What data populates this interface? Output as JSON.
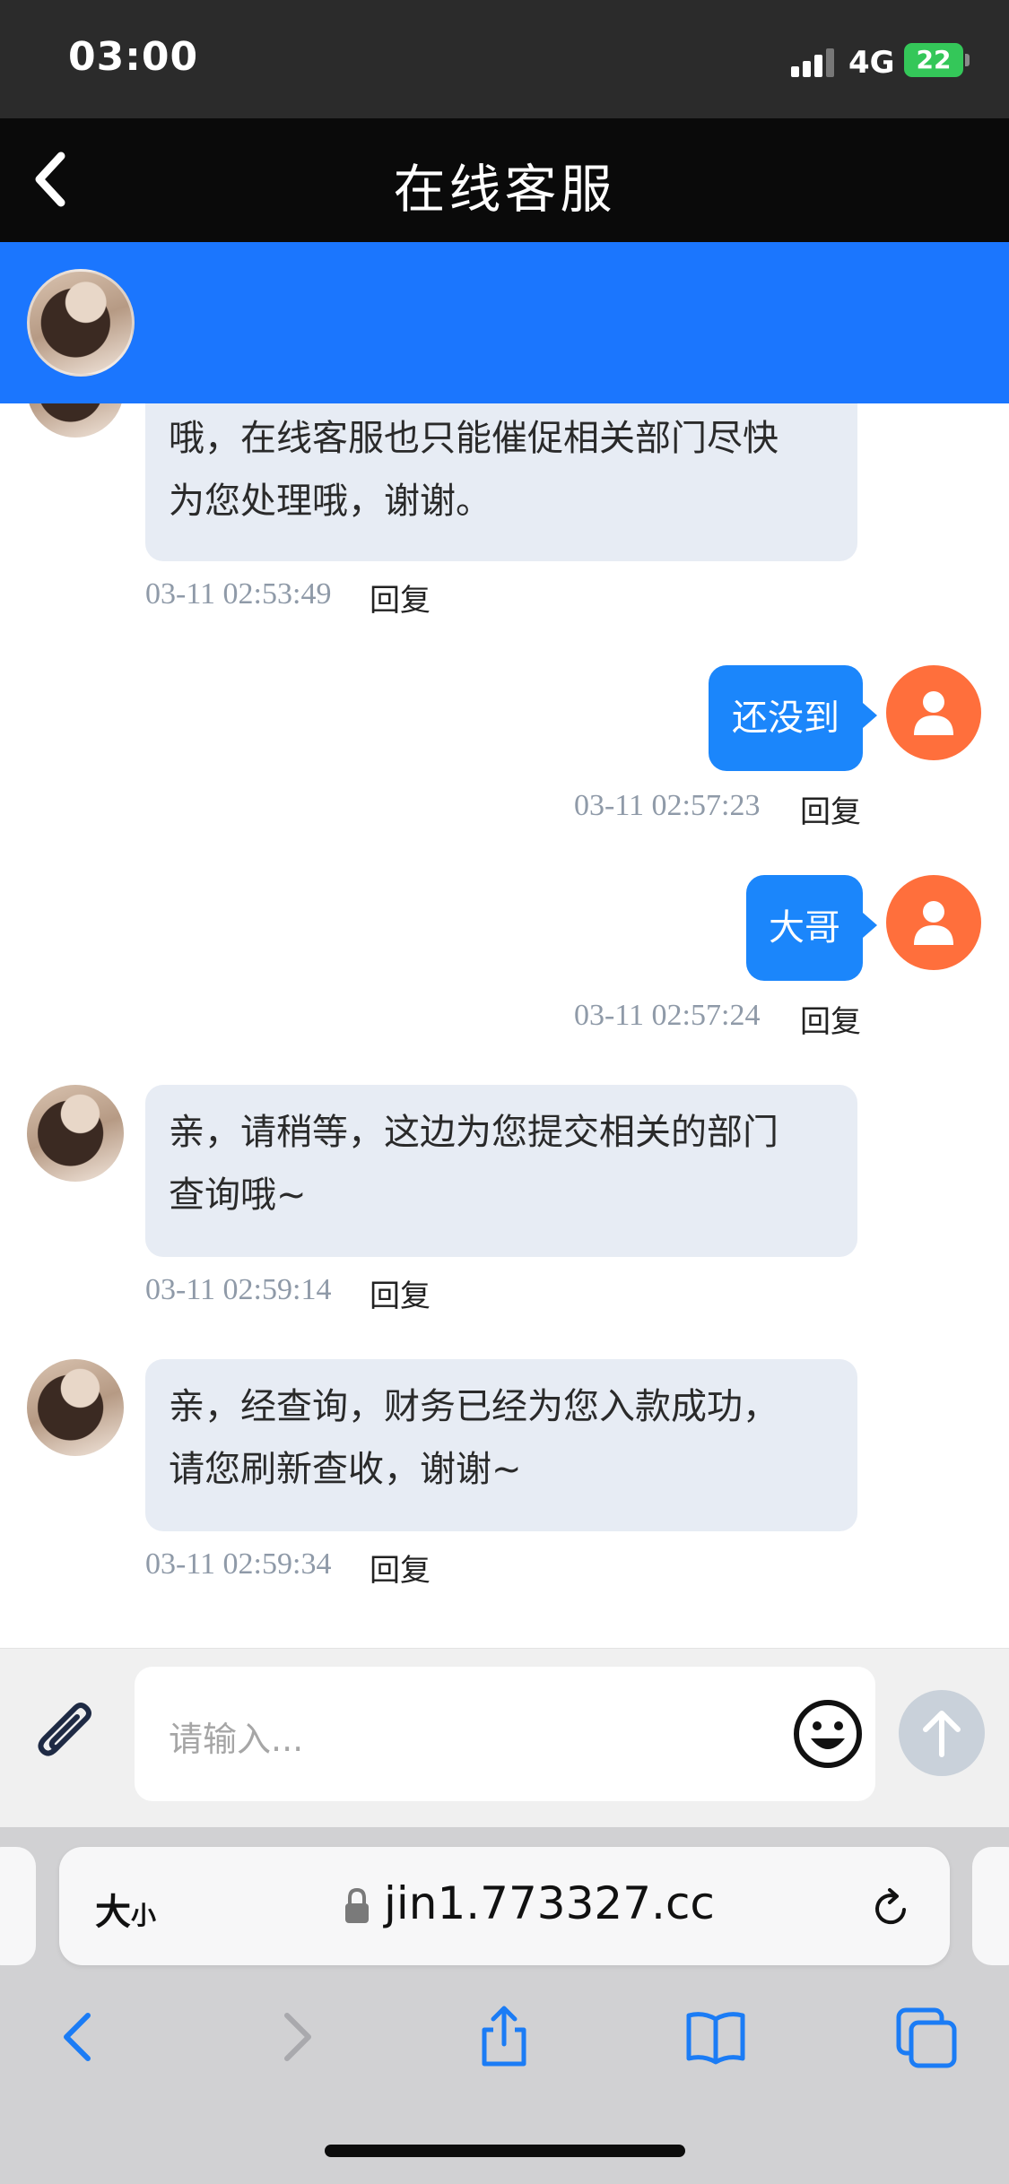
{
  "status_bar": {
    "time": "03:00",
    "network": "4G",
    "battery": "22"
  },
  "nav": {
    "title": "在线客服"
  },
  "messages": [
    {
      "side": "left",
      "lines": [
        "哦，在线客服也只能催促相关部门尽快",
        "为您处理哦，谢谢。"
      ],
      "time": "03-11 02:53:49",
      "reply": "回复"
    },
    {
      "side": "right",
      "lines": [
        "还没到"
      ],
      "time": "03-11 02:57:23",
      "reply": "回复"
    },
    {
      "side": "right",
      "lines": [
        "大哥"
      ],
      "time": "03-11 02:57:24",
      "reply": "回复"
    },
    {
      "side": "left",
      "lines": [
        "亲，请稍等，这边为您提交相关的部门",
        "查询哦~"
      ],
      "time": "03-11 02:59:14",
      "reply": "回复"
    },
    {
      "side": "left",
      "lines": [
        "亲，经查询，财务已经为您入款成功，",
        "请您刷新查收，谢谢~"
      ],
      "time": "03-11 02:59:34",
      "reply": "回复"
    }
  ],
  "input": {
    "placeholder": "请输入..."
  },
  "browser": {
    "text_size_big": "大",
    "text_size_small": "小",
    "url": "jin1.773327.cc"
  },
  "colors": {
    "accent": "#1b76fe",
    "bubble_right": "#1b86fb",
    "bubble_left": "#e7ecf4",
    "user_avatar": "#ff6f3c"
  },
  "icons": [
    "back-icon",
    "attach-icon",
    "emoji-icon",
    "send-icon",
    "lock-icon",
    "reload-icon",
    "browser-back-icon",
    "browser-forward-icon",
    "share-icon",
    "bookmarks-icon",
    "tabs-icon"
  ]
}
